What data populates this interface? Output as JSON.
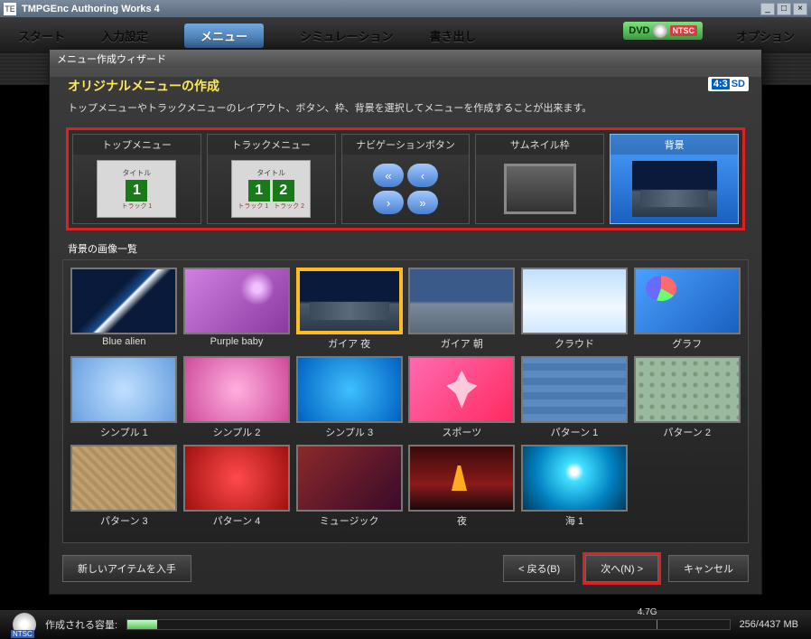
{
  "app": {
    "title": "TMPGEnc Authoring Works 4"
  },
  "window_buttons": {
    "min": "_",
    "max": "□",
    "close": "×"
  },
  "topnav": {
    "tabs": [
      "スタート",
      "入力設定",
      "メニュー",
      "シミュレーション",
      "書き出し"
    ],
    "dvd_label": "DVD",
    "ntsc": "NTSC",
    "option": "オプション"
  },
  "wizard": {
    "title": "メニュー作成ウィザード",
    "heading": "オリジナルメニューの作成",
    "desc": "トップメニューやトラックメニューのレイアウト、ボタン、枠、背景を選択してメニューを作成することが出来ます。",
    "aspect": "4:3",
    "sd": "SD",
    "categories": [
      {
        "label": "トップメニュー",
        "kind": "top"
      },
      {
        "label": "トラックメニュー",
        "kind": "track"
      },
      {
        "label": "ナビゲーションボタン",
        "kind": "nav"
      },
      {
        "label": "サムネイル枠",
        "kind": "thumb"
      },
      {
        "label": "背景",
        "kind": "bg",
        "selected": true
      }
    ],
    "mock": {
      "title": "タイトル",
      "track1": "トラック 1",
      "track2": "トラック 2"
    },
    "gallery_label": "背景の画像一覧",
    "gallery": [
      {
        "label": "Blue alien",
        "cls": "bg-bluealien"
      },
      {
        "label": "Purple baby",
        "cls": "bg-purple"
      },
      {
        "label": "ガイア 夜",
        "cls": "bg-gaia-night",
        "selected": true
      },
      {
        "label": "ガイア 朝",
        "cls": "bg-gaia-morn"
      },
      {
        "label": "クラウド",
        "cls": "bg-cloud"
      },
      {
        "label": "グラフ",
        "cls": "bg-graph"
      },
      {
        "label": "シンプル 1",
        "cls": "bg-simple1"
      },
      {
        "label": "シンプル 2",
        "cls": "bg-simple2"
      },
      {
        "label": "シンプル 3",
        "cls": "bg-simple3"
      },
      {
        "label": "スポーツ",
        "cls": "bg-sports"
      },
      {
        "label": "パターン 1",
        "cls": "bg-pattern1"
      },
      {
        "label": "パターン 2",
        "cls": "bg-pattern2"
      },
      {
        "label": "パターン 3",
        "cls": "bg-pattern3"
      },
      {
        "label": "パターン 4",
        "cls": "bg-pattern4"
      },
      {
        "label": "ミュージック",
        "cls": "bg-music"
      },
      {
        "label": "夜",
        "cls": "bg-night"
      },
      {
        "label": "海 1",
        "cls": "bg-sea1"
      }
    ],
    "footer": {
      "get_new": "新しいアイテムを入手",
      "back": "戻る(B)",
      "next": "次へ(N)",
      "cancel": "キャンセル"
    }
  },
  "storage": {
    "label": "作成される容量:",
    "marker": "4.7G",
    "size": "256/4437 MB",
    "ntsc": "NTSC"
  }
}
